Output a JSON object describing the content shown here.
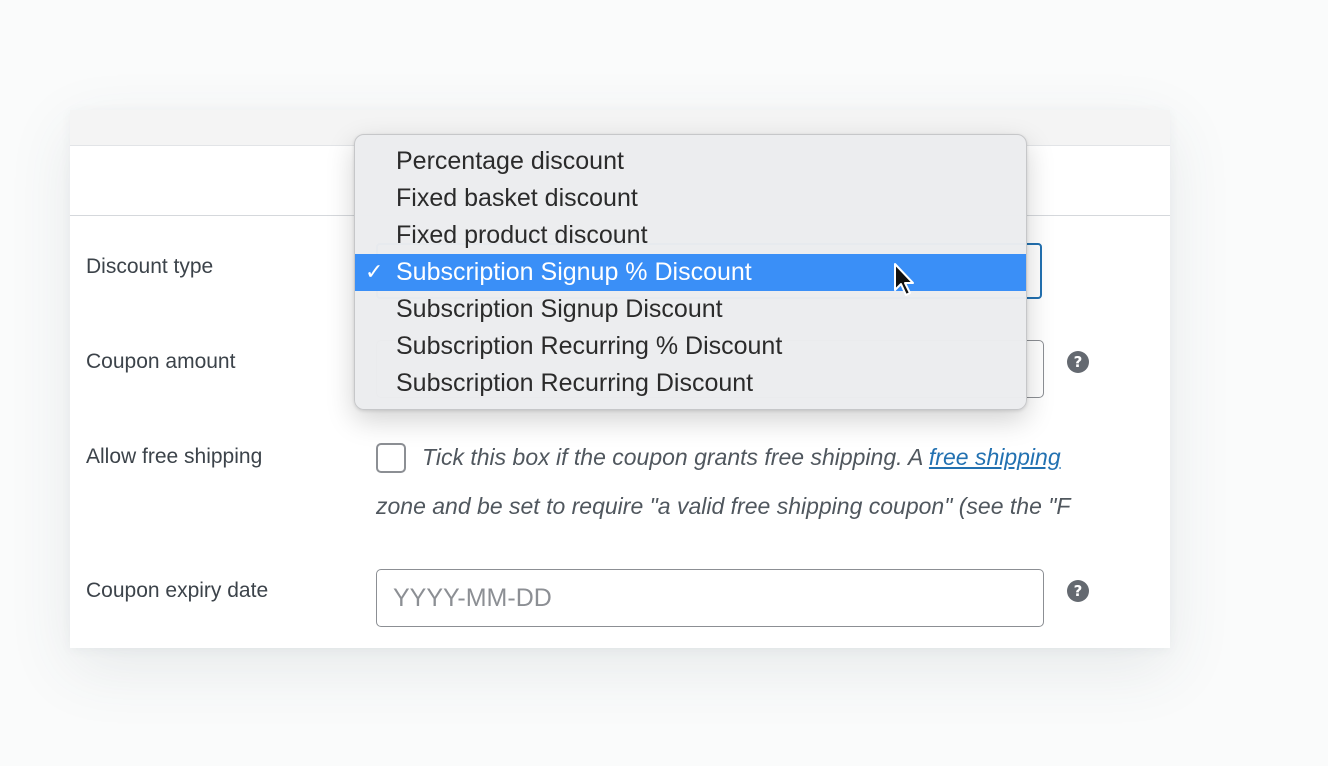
{
  "form": {
    "discount_type_label": "Discount type",
    "coupon_amount_label": "Coupon amount",
    "free_shipping_label": "Allow free shipping",
    "free_shipping_desc_part1": "Tick this box if the coupon grants free shipping. A ",
    "free_shipping_link": "free shipping",
    "free_shipping_desc_line2": "zone and be set to require \"a valid free shipping coupon\" (see the \"F",
    "expiry_label": "Coupon expiry date",
    "expiry_placeholder": "YYYY-MM-DD",
    "help_glyph": "?"
  },
  "dropdown": {
    "check_glyph": "✓",
    "options": [
      "Percentage discount",
      "Fixed basket discount",
      "Fixed product discount",
      "Subscription Signup % Discount",
      "Subscription Signup Discount",
      "Subscription Recurring % Discount",
      "Subscription Recurring Discount"
    ],
    "selected_index": 3
  },
  "colors": {
    "accent": "#2271b1",
    "highlight": "#3a8ff7",
    "label_text": "#3c434a"
  },
  "icons": {
    "help": "help-circle-icon",
    "cursor": "mouse-pointer-icon",
    "check": "checkmark-icon"
  }
}
